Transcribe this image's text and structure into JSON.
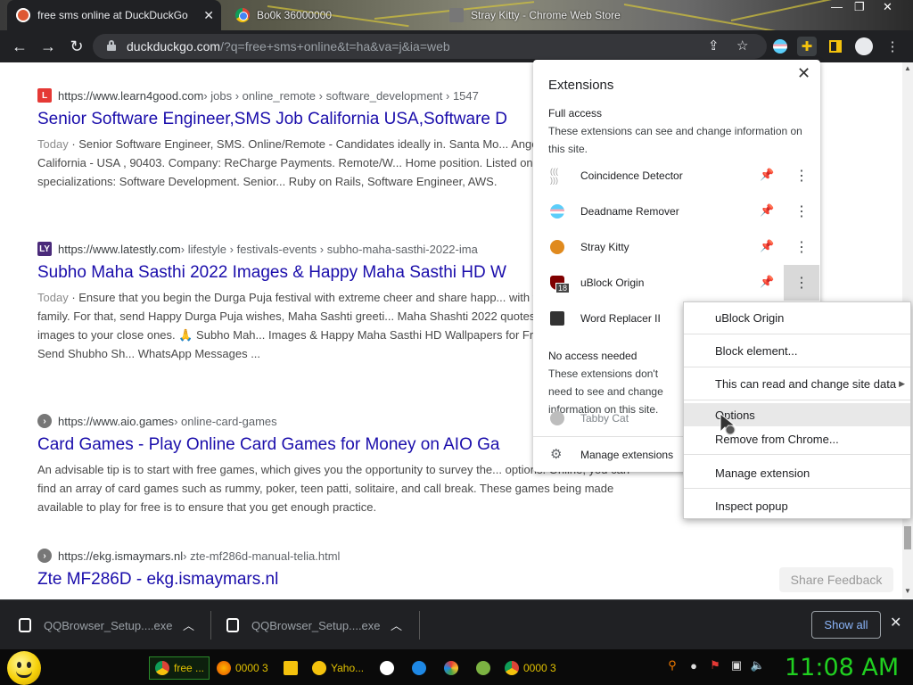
{
  "tabs": [
    {
      "title": "free sms online at DuckDuckGo",
      "active": true
    },
    {
      "title": "Bo0k 36000000",
      "active": false
    },
    {
      "title": "Stray Kitty - Chrome Web Store",
      "active": false
    }
  ],
  "toolbar": {
    "url_host": "duckduckgo.com",
    "url_rest": "/?q=free+sms+online&t=ha&va=j&ia=web"
  },
  "results": [
    {
      "favicon_letter": "L",
      "favicon_color": "#e53935",
      "url_host": "https://www.learn4good.com",
      "url_path": " › jobs › online_remote › software_development › 1547",
      "title": "Senior Software Engineer,SMS Job California USA,Software D",
      "date": "Today",
      "snippet": "Senior Software Engineer, SMS. Online/Remote - Candidates ideally in. Santa Mo... Angeles County - CA California - USA , 90403. Company: ReCharge Payments. Remote/W... Home position. Listed on 2022-10-01. Job specializations: Software Development. Senior... Ruby on Rails, Software Engineer, AWS."
    },
    {
      "favicon_letter": "LY",
      "favicon_color": "#4a2a7a",
      "url_host": "https://www.latestly.com",
      "url_path": " › lifestyle › festivals-events › subho-maha-sasthi-2022-ima",
      "title": "Subho Maha Sasthi 2022 Images & Happy Maha Sasthi HD W",
      "date": "Today",
      "snippet": "Ensure that you begin the Durga Puja festival with extreme cheer and share happ... with your friends and family. For that, send Happy Durga Puja wishes, Maha Sashti greeti... Maha Shashti 2022 quotes and Goddess Durga images to your close ones. 🙏 Subho Mah... Images & Happy Maha Sasthi HD Wallpapers for Free Download Online: Send Shubho Sh... WhatsApp Messages ..."
    },
    {
      "favicon_letter": "",
      "favicon_color": "#777777",
      "url_host": "https://www.aio.games",
      "url_path": " › online-card-games",
      "title": "Card Games - Play Online Card Games for Money on AIO Ga",
      "date": "",
      "snippet": "An advisable tip is to start with free games, which gives you the opportunity to survey the... options. Online, you can find an array of card games such as rummy, poker, teen patti, solitaire, and call break. These games being made available to play for free is to ensure that you get enough practice."
    },
    {
      "favicon_letter": "",
      "favicon_color": "#777777",
      "url_host": "https://ekg.ismaymars.nl",
      "url_path": " › zte-mf286d-manual-telia.html",
      "title": "Zte MF286D - ekg.ismaymars.nl",
      "date": "",
      "snippet": ""
    }
  ],
  "extensions_popup": {
    "title": "Extensions",
    "full_access_heading": "Full access",
    "full_access_desc": "These extensions can see and change information on this site.",
    "full_access": [
      {
        "name": "Coincidence Detector",
        "pinned": false,
        "icon_color": "#9e9e9e"
      },
      {
        "name": "Deadname Remover",
        "pinned": true,
        "icon_color": "#f48fb1"
      },
      {
        "name": "Stray Kitty",
        "pinned": false,
        "icon_color": "#e08a1e"
      },
      {
        "name": "uBlock Origin",
        "pinned": false,
        "icon_color": "#800000",
        "badge": "18"
      },
      {
        "name": "Word Replacer II",
        "pinned": false,
        "icon_color": "#333333"
      }
    ],
    "no_access_heading": "No access needed",
    "no_access_desc": "These extensions don't need to see and change information on this site.",
    "no_access": [
      {
        "name": "Tabby Cat",
        "icon_color": "#bdbdbd"
      }
    ],
    "manage_label": "Manage extensions"
  },
  "context_menu": {
    "items": [
      "uBlock Origin",
      "Block element...",
      "This can read and change site data",
      "Options",
      "Remove from Chrome...",
      "Manage extension",
      "Inspect popup"
    ],
    "hovered": "Options"
  },
  "share_feedback": "Share Feedback",
  "downloads": [
    {
      "name": "QQBrowser_Setup....exe"
    },
    {
      "name": "QQBrowser_Setup....exe"
    }
  ],
  "show_all": "Show all",
  "taskbar": {
    "tasks": [
      "free ...",
      "0000 3...",
      "",
      "Yaho...",
      "",
      "",
      "",
      "",
      "0000 3..."
    ],
    "clock": "11:08 AM"
  }
}
